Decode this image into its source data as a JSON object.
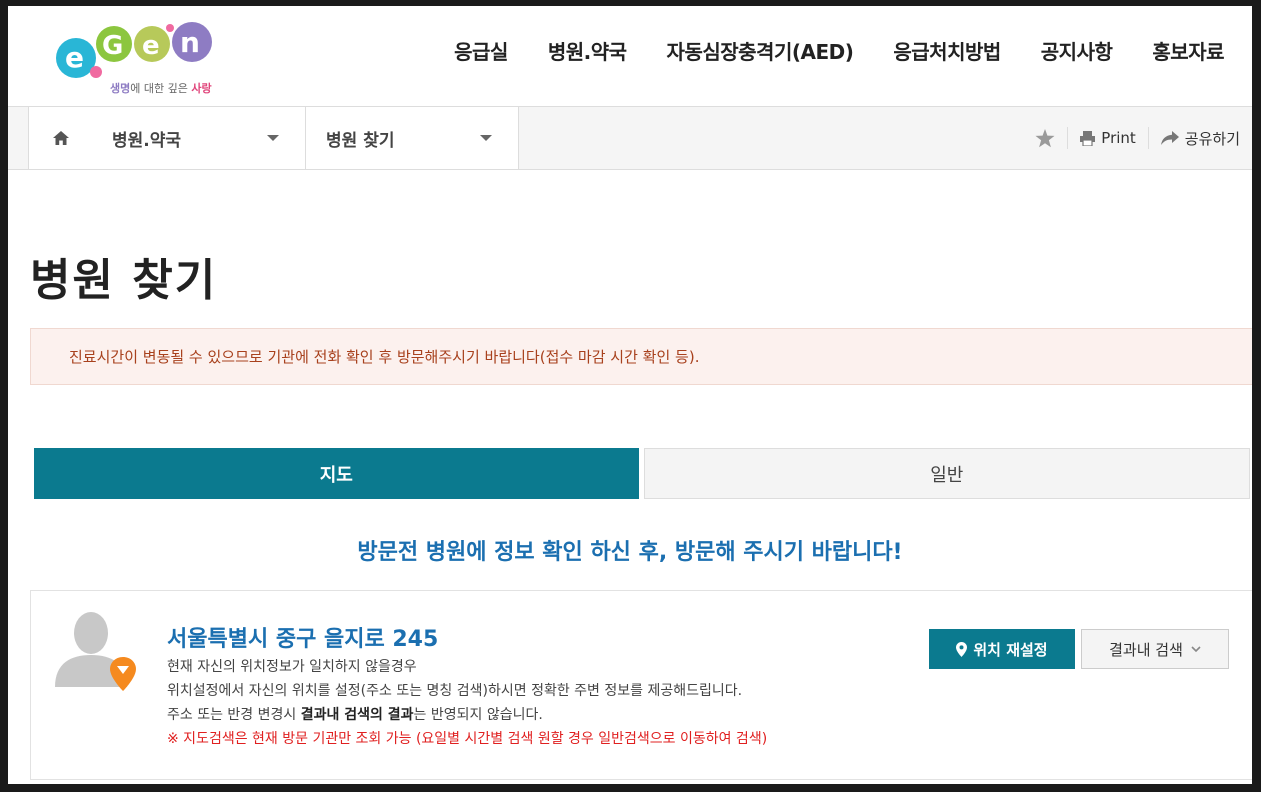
{
  "logo": {
    "letters": [
      "e",
      "G",
      "e",
      "n"
    ],
    "tagline_a": "생명",
    "tagline_b": "에 대한 깊은 ",
    "tagline_c": "사랑"
  },
  "nav": [
    "응급실",
    "병원.약국",
    "자동심장충격기(AED)",
    "응급처치방법",
    "공지사항",
    "홍보자료"
  ],
  "breadcrumb": {
    "level1": "병원.약국",
    "level2": "병원 찾기"
  },
  "tools": {
    "print": "Print",
    "share": "공유하기"
  },
  "page_title": "병원 찾기",
  "notice": "진료시간이 변동될 수 있으므로 기관에 전화 확인 후 방문해주시기 바랍니다(접수 마감 시간 확인 등).",
  "tabs": {
    "map": "지도",
    "general": "일반"
  },
  "headline": "방문전 병원에 정보 확인 하신 후, 방문해 주시기 바랍니다!",
  "location": {
    "address": "서울특별시 중구 을지로 245",
    "line1": "현재 자신의 위치정보가 일치하지 않을경우",
    "line2": "위치설정에서 자신의 위치를 설정(주소 또는 명칭 검색)하시면 정확한 주변 정보를 제공해드립니다.",
    "line3_pre": "주소 또는 반경 변경시 ",
    "line3_bold": "결과내 검색의 결과",
    "line3_post": "는 반영되지 않습니다.",
    "warning": "※ 지도검색은 현재 방문 기관만 조회 가능 (요일별 시간별 검색 원할 경우 일반검색으로 이동하여 검색)",
    "reset_button": "위치 재설정",
    "filter_button": "결과내 검색"
  },
  "colors": {
    "teal": "#0b7a8f",
    "blue": "#1b6fb0",
    "warning": "#e02020",
    "notice_text": "#a8411d"
  }
}
